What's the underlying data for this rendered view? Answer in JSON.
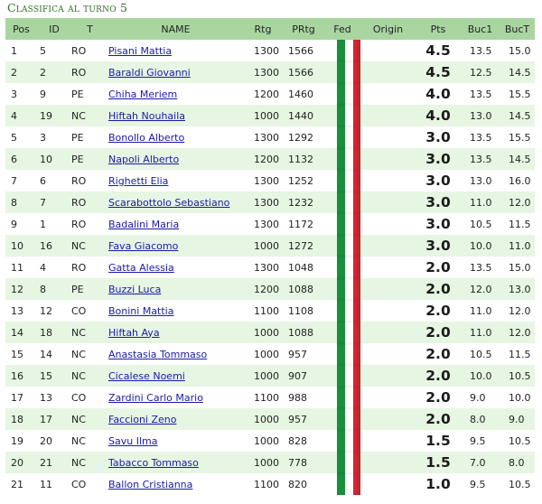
{
  "page": {
    "title": "Classifica al turno 5"
  },
  "columns": {
    "pos": "Pos",
    "id": "ID",
    "t": "T",
    "name": "NAME",
    "rtg": "Rtg",
    "prtg": "PRtg",
    "fed": "Fed",
    "origin": "Origin",
    "pts": "Pts",
    "buc1": "Buc1",
    "buct": "BucT"
  },
  "flag_colors": [
    "#1a8f3d",
    "#ffffff",
    "#d22630"
  ],
  "rows": [
    {
      "pos": "1",
      "id": "5",
      "t": "RO",
      "name": "Pisani Mattia",
      "rtg": "1300",
      "prtg": "1566",
      "origin": "",
      "pts": "4.5",
      "buc1": "13.5",
      "buct": "15.0"
    },
    {
      "pos": "2",
      "id": "2",
      "t": "RO",
      "name": "Baraldi Giovanni",
      "rtg": "1300",
      "prtg": "1566",
      "origin": "",
      "pts": "4.5",
      "buc1": "12.5",
      "buct": "14.5"
    },
    {
      "pos": "3",
      "id": "9",
      "t": "PE",
      "name": "Chiha Meriem",
      "rtg": "1200",
      "prtg": "1460",
      "origin": "",
      "pts": "4.0",
      "buc1": "13.5",
      "buct": "15.5"
    },
    {
      "pos": "4",
      "id": "19",
      "t": "NC",
      "name": "Hiftah Nouhaila",
      "rtg": "1000",
      "prtg": "1440",
      "origin": "",
      "pts": "4.0",
      "buc1": "13.0",
      "buct": "14.5"
    },
    {
      "pos": "5",
      "id": "3",
      "t": "PE",
      "name": "Bonollo Alberto",
      "rtg": "1300",
      "prtg": "1292",
      "origin": "",
      "pts": "3.0",
      "buc1": "13.5",
      "buct": "15.5"
    },
    {
      "pos": "6",
      "id": "10",
      "t": "PE",
      "name": "Napoli Alberto",
      "rtg": "1200",
      "prtg": "1132",
      "origin": "",
      "pts": "3.0",
      "buc1": "13.5",
      "buct": "14.5"
    },
    {
      "pos": "7",
      "id": "6",
      "t": "RO",
      "name": "Righetti Elia",
      "rtg": "1300",
      "prtg": "1252",
      "origin": "",
      "pts": "3.0",
      "buc1": "13.0",
      "buct": "16.0"
    },
    {
      "pos": "8",
      "id": "7",
      "t": "RO",
      "name": "Scarabottolo Sebastiano",
      "rtg": "1300",
      "prtg": "1232",
      "origin": "",
      "pts": "3.0",
      "buc1": "11.0",
      "buct": "12.0"
    },
    {
      "pos": "9",
      "id": "1",
      "t": "RO",
      "name": "Badalini Maria",
      "rtg": "1300",
      "prtg": "1172",
      "origin": "",
      "pts": "3.0",
      "buc1": "10.5",
      "buct": "11.5"
    },
    {
      "pos": "10",
      "id": "16",
      "t": "NC",
      "name": "Fava Giacomo",
      "rtg": "1000",
      "prtg": "1272",
      "origin": "",
      "pts": "3.0",
      "buc1": "10.0",
      "buct": "11.0"
    },
    {
      "pos": "11",
      "id": "4",
      "t": "RO",
      "name": "Gatta Alessia",
      "rtg": "1300",
      "prtg": "1048",
      "origin": "",
      "pts": "2.0",
      "buc1": "13.5",
      "buct": "15.0"
    },
    {
      "pos": "12",
      "id": "8",
      "t": "PE",
      "name": "Buzzi Luca",
      "rtg": "1200",
      "prtg": "1088",
      "origin": "",
      "pts": "2.0",
      "buc1": "12.0",
      "buct": "13.0"
    },
    {
      "pos": "13",
      "id": "12",
      "t": "CO",
      "name": "Bonini Mattia",
      "rtg": "1100",
      "prtg": "1108",
      "origin": "",
      "pts": "2.0",
      "buc1": "11.0",
      "buct": "12.0"
    },
    {
      "pos": "14",
      "id": "18",
      "t": "NC",
      "name": "Hiftah Aya",
      "rtg": "1000",
      "prtg": "1088",
      "origin": "",
      "pts": "2.0",
      "buc1": "11.0",
      "buct": "12.0"
    },
    {
      "pos": "15",
      "id": "14",
      "t": "NC",
      "name": "Anastasia Tommaso",
      "rtg": "1000",
      "prtg": "957",
      "origin": "",
      "pts": "2.0",
      "buc1": "10.5",
      "buct": "11.5"
    },
    {
      "pos": "16",
      "id": "15",
      "t": "NC",
      "name": "Cicalese Noemi",
      "rtg": "1000",
      "prtg": "907",
      "origin": "",
      "pts": "2.0",
      "buc1": "10.0",
      "buct": "10.5"
    },
    {
      "pos": "17",
      "id": "13",
      "t": "CO",
      "name": "Zardini Carlo Mario",
      "rtg": "1100",
      "prtg": "988",
      "origin": "",
      "pts": "2.0",
      "buc1": "9.0",
      "buct": "10.0"
    },
    {
      "pos": "18",
      "id": "17",
      "t": "NC",
      "name": "Faccioni Zeno",
      "rtg": "1000",
      "prtg": "957",
      "origin": "",
      "pts": "2.0",
      "buc1": "8.0",
      "buct": "9.0"
    },
    {
      "pos": "19",
      "id": "20",
      "t": "NC",
      "name": "Savu Ilma",
      "rtg": "1000",
      "prtg": "828",
      "origin": "",
      "pts": "1.5",
      "buc1": "9.5",
      "buct": "10.5"
    },
    {
      "pos": "20",
      "id": "21",
      "t": "NC",
      "name": "Tabacco Tommaso",
      "rtg": "1000",
      "prtg": "778",
      "origin": "",
      "pts": "1.5",
      "buc1": "7.0",
      "buct": "8.0"
    },
    {
      "pos": "21",
      "id": "11",
      "t": "CO",
      "name": "Ballon Cristianna",
      "rtg": "1100",
      "prtg": "820",
      "origin": "",
      "pts": "1.0",
      "buc1": "9.5",
      "buct": "10.5"
    }
  ]
}
